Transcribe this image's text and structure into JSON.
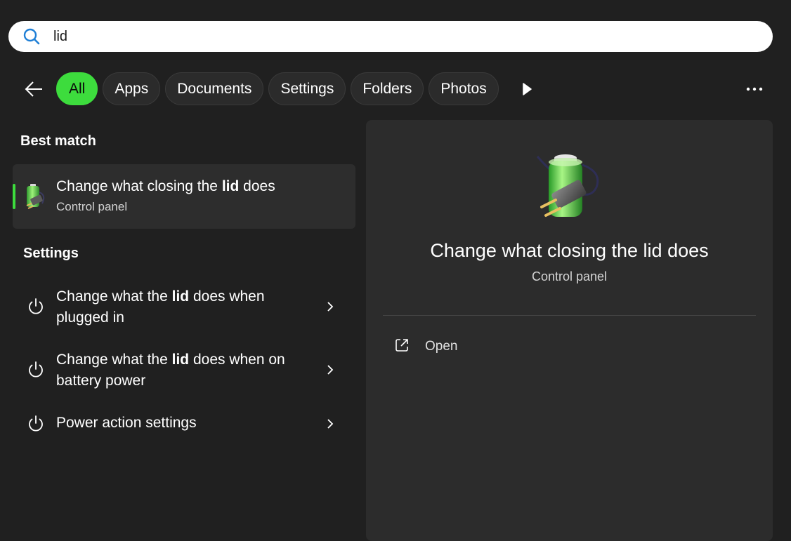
{
  "search": {
    "query": "lid",
    "icon": "search-icon"
  },
  "filters": {
    "back_icon": "back-arrow-icon",
    "chips": [
      "All",
      "Apps",
      "Documents",
      "Settings",
      "Folders",
      "Photos"
    ],
    "active": "All",
    "more_scroll_icon": "play-arrow-icon",
    "more_icon": "ellipsis-icon"
  },
  "best_match": {
    "heading": "Best match",
    "title_before": "Change what closing the ",
    "title_bold": "lid",
    "title_after": " does",
    "subtitle": "Control panel",
    "icon": "battery-plug-icon"
  },
  "settings": {
    "heading": "Settings",
    "items": [
      {
        "line1_before": "Change what the ",
        "bold": "lid",
        "line1_after": " does when",
        "line2": "plugged in",
        "icon": "power-icon"
      },
      {
        "line1_before": "Change what the ",
        "bold": "lid",
        "line1_after": " does when on",
        "line2": "battery power",
        "icon": "power-icon"
      },
      {
        "label": "Power action settings",
        "icon": "power-icon"
      }
    ]
  },
  "detail": {
    "title": "Change what closing the lid does",
    "subtitle": "Control panel",
    "open_label": "Open",
    "open_icon": "open-external-icon"
  },
  "colors": {
    "accent": "#3ddc3d",
    "background": "#202020",
    "panel": "#2c2c2c"
  }
}
